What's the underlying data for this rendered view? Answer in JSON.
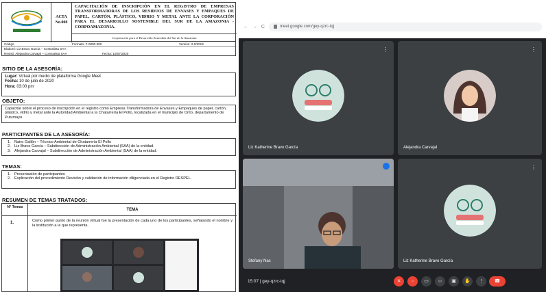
{
  "document": {
    "header": {
      "acta_label": "ACTA",
      "acta_number": "No.008",
      "title": "CAPACITACIÓN DE INSCRIPCIÓN EN EL REGISTRO DE EMPRESAS TRANSFORMADORAS DE LOS RESIDUOS DE ENVASES Y EMPAQUES DE PAPEL, CARTÓN, PLÁSTICO, VIDRIO Y METAL ANTE LA CORPORACIÓN PARA EL DESARROLLO SOSTENIBLE DEL SUR DE LA AMAZONIA - CORPOAMAZONIA.",
      "corporation_line": "Corporación para el Desarrollo Sostenible del Sur de la Amazonia",
      "logo_text": "CORPOAMAZONIA"
    },
    "meta": {
      "codigo_label": "Código",
      "formato": "Formato: F-0000-000",
      "version": "Versión: 2.0/2019",
      "elaboro": "Elaboró: Liz Bravo García – Contratista SAA",
      "reviso": "Revisó: Alejandra Carvajal – Contratista SAA",
      "fecha": "Fecha: 10/07/2020"
    },
    "sitio": {
      "heading": "SITIO DE LA ASESORÍA:",
      "lugar_label": "Lugar:",
      "lugar_value": "Virtual por medio de plataforma Google Meet",
      "fecha_label": "Fecha:",
      "fecha_value": "10 de julio de 2020",
      "hora_label": "Hora:",
      "hora_value": "03:00 pm"
    },
    "objeto": {
      "heading": "OBJETO:",
      "text": "Capacitar sobre el proceso de inscripción en el registro como Empresa Transformadora de Envases y Empaques de papel, cartón, plástico, vidrio y metal ante la Autoridad Ambiental a la Chatarrería El Pollo, localizada en el municipio de Orito, departamento de Putumayo."
    },
    "participantes": {
      "heading": "PARTICIPANTES DE LA ASESORÍA:",
      "items": [
        "Nairo Gallón – Técnico Ambiental de Chatarrería El Pollo",
        "Liz Bravo García – Subdirección de Administración Ambiental (SAA) de la entidad.",
        "Alejandra Carvajal – Subdirección de Administración Ambiental (SAA) de la entidad."
      ]
    },
    "temas": {
      "heading": "TEMAS:",
      "items": [
        "Presentación de participantes",
        "Explicación del procedimiento Revisión y validación de información diligenciada en el Registro RESPEL."
      ]
    },
    "resumen": {
      "heading": "RESUMEN DE TEMAS TRATADOS:",
      "col_num": "N° Temas",
      "col_tema": "TEMA",
      "row_num": "1.",
      "row_text": "Como primer punto de la reunión virtual fue la presentación de cada uno de los participantes, señalando el nombre y la institución a la que representa."
    }
  },
  "meet": {
    "browser": {
      "nav_icons": "← → C",
      "url": "meet.google.com/gey-qzrc-tqj"
    },
    "tiles": [
      {
        "name": "Liz Katherine Bravo García"
      },
      {
        "name": "Alejandra Carvajal"
      },
      {
        "name": "Stefany Nas"
      },
      {
        "name": "Liz Katherine Bravo García"
      }
    ],
    "bottom": {
      "time_code": "15:07 | gey-qzrc-tqj"
    },
    "colors": {
      "background": "#202124",
      "tile": "#3c4043",
      "end_call": "#ea4335",
      "avatar_bg": "#cfe3dc"
    }
  }
}
